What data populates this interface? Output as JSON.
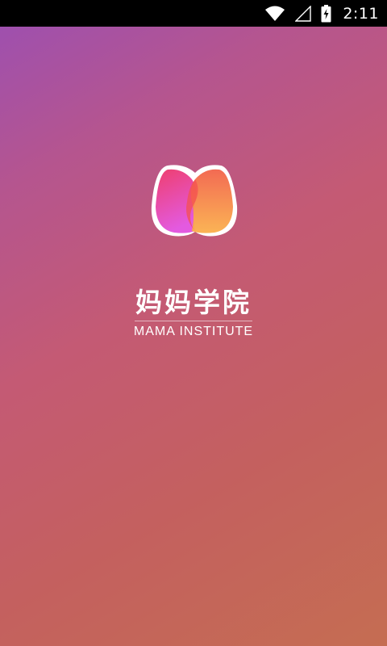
{
  "status_bar": {
    "time": "2:11",
    "icons": [
      "wifi-icon",
      "signal-icon",
      "battery-charging-icon"
    ]
  },
  "splash": {
    "title": "妈妈学院",
    "subtitle": "MAMA INSTITUTE",
    "logo": "heart-logo-icon"
  },
  "colors": {
    "gradient_top_left": "#9b4fb3",
    "gradient_mid": "#c45a74",
    "gradient_bottom_right": "#c56d52",
    "logo_pink": "#ee4f8a",
    "logo_orange": "#f59a4a",
    "status_bar": "#000000"
  }
}
